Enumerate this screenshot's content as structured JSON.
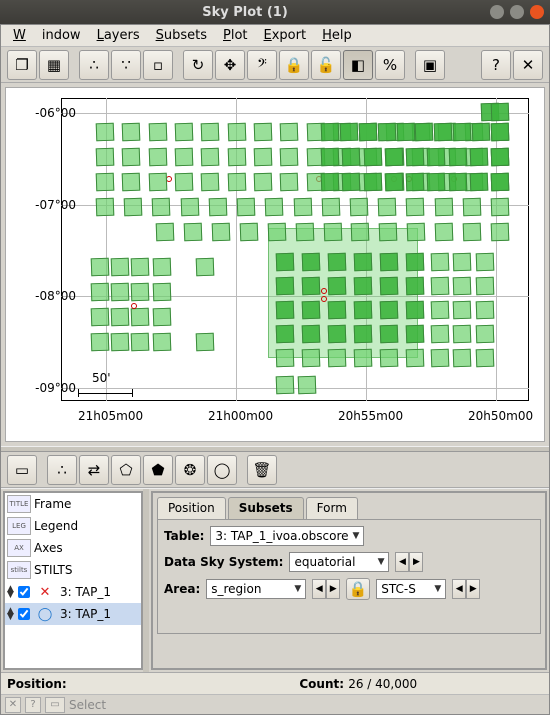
{
  "window": {
    "title": "Sky Plot (1)"
  },
  "menu": {
    "items": [
      "Window",
      "Layers",
      "Subsets",
      "Plot",
      "Export",
      "Help"
    ]
  },
  "toolbar_main": [
    {
      "name": "new-window-icon"
    },
    {
      "name": "overlay-icon"
    },
    {
      "sep": true
    },
    {
      "name": "mark1-icon"
    },
    {
      "name": "mark2-icon"
    },
    {
      "name": "mark3-icon"
    },
    {
      "sep": true
    },
    {
      "name": "replot-icon"
    },
    {
      "name": "resize-icon"
    },
    {
      "name": "measure-icon"
    },
    {
      "name": "lock-x-icon"
    },
    {
      "name": "lock-y-icon"
    },
    {
      "name": "aux-icon",
      "pressed": true
    },
    {
      "name": "range-icon"
    },
    {
      "sep": true
    },
    {
      "name": "legend-icon"
    },
    {
      "spacer": true
    },
    {
      "name": "help-icon"
    },
    {
      "name": "close-icon"
    }
  ],
  "plot": {
    "y_ticks": [
      "-06°00",
      "-07°00",
      "-08°00",
      "-09°00"
    ],
    "x_ticks": [
      "21h05m00",
      "21h00m00",
      "20h55m00",
      "20h50m00"
    ],
    "scale_label": "50'"
  },
  "layer_toolbar": [
    {
      "name": "frame-control-icon"
    },
    {
      "sep": true
    },
    {
      "name": "add-marks-icon"
    },
    {
      "name": "add-pair-icon"
    },
    {
      "name": "add-area-icon"
    },
    {
      "name": "add-poly-icon"
    },
    {
      "name": "add-healpix-icon"
    },
    {
      "name": "add-sphere-icon"
    },
    {
      "sep": true
    },
    {
      "name": "delete-layer-icon"
    }
  ],
  "layers": {
    "items": [
      {
        "icon_label": "TITLE",
        "label": "Frame",
        "interactable": true
      },
      {
        "icon_label": "LEG",
        "label": "Legend",
        "interactable": true
      },
      {
        "icon_label": "AX",
        "label": "Axes",
        "interactable": true
      },
      {
        "icon_label": "stilts",
        "label": "STILTS",
        "interactable": true
      },
      {
        "icon_label": "⬍ ☑",
        "label": "3: TAP_1",
        "interactable": true,
        "checked": true,
        "mark": "✕",
        "mark_color": "#d22"
      },
      {
        "icon_label": "⬍ ☑",
        "label": "3: TAP_1",
        "interactable": true,
        "checked": true,
        "mark": "◯",
        "mark_color": "#27c",
        "selected": true
      }
    ]
  },
  "tabs": {
    "items": [
      "Position",
      "Subsets",
      "Form"
    ],
    "active": 1
  },
  "form": {
    "table_label": "Table:",
    "table_value": "3: TAP_1_ivoa.obscore",
    "sky_label": "Data Sky System:",
    "sky_value": "equatorial",
    "area_label": "Area:",
    "area_value": "s_region",
    "area_format": "STC-S"
  },
  "status": {
    "pos_label": "Position:",
    "count_label": "Count:",
    "count_value": "26 / 40,000"
  },
  "bottom": {
    "select_label": "Select"
  }
}
